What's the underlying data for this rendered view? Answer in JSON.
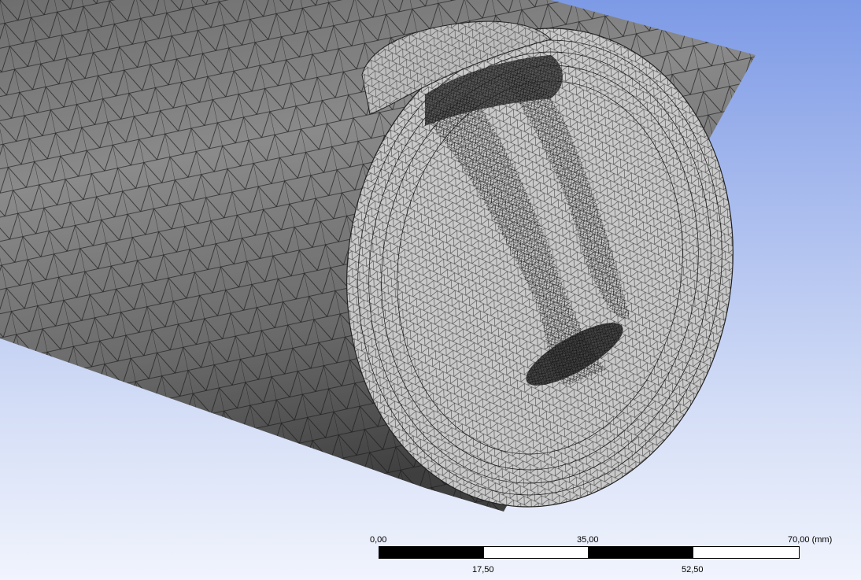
{
  "viewport": {
    "background_top": "#7d9ae6",
    "background_bottom": "#f1f4fd"
  },
  "model": {
    "surface_color": "#7f7f7f",
    "section_face_color": "#c8c8c8",
    "mesh_line_color": "#111111"
  },
  "scale_bar": {
    "labels_top": [
      "0,00",
      "35,00",
      "70,00 (mm)"
    ],
    "labels_bottom": [
      "17,50",
      "52,50"
    ],
    "segment_colors": [
      "#000000",
      "#ffffff",
      "#000000",
      "#ffffff"
    ]
  }
}
